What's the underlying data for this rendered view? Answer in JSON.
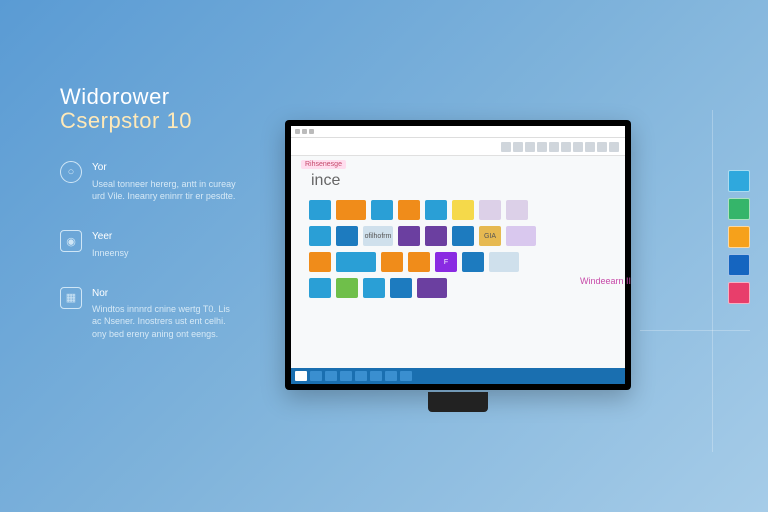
{
  "brand": {
    "line1": "Widorower",
    "line2": "Cserpstor 10"
  },
  "features": [
    {
      "title": "Yor",
      "body": "Useal tonneer hererg, antt in cureay urd Vile. Ineanry eninrr tir er pesdte."
    },
    {
      "title": "Yeer",
      "body": "Inneensy"
    },
    {
      "title": "Nor",
      "body": "Windtos innnrd cnine wertg T0. Lis ac Nsener. Inostrers ust ent celhi. ony bed ereny aning ont eengs."
    }
  ],
  "window": {
    "url_chip": "Rihsenesge",
    "doc_title": "ince",
    "caption_right": "Windeearn II",
    "ribbon_count": 10,
    "taskbar_count": 8
  },
  "tiles": {
    "row1": [
      {
        "c": "#2a9fd6",
        "w": "sm"
      },
      {
        "c": "#f08c1a",
        "w": "md"
      },
      {
        "c": "#2a9fd6",
        "w": "sm"
      },
      {
        "c": "#f08c1a",
        "w": "sm"
      },
      {
        "c": "#2a9fd6",
        "w": "sm"
      },
      {
        "c": "#f5d94a",
        "w": "sm"
      },
      {
        "c": "#dcd0e8",
        "w": "sm"
      },
      {
        "c": "#dcd0e8",
        "w": "sm"
      }
    ],
    "row2": [
      {
        "c": "#2a9fd6",
        "w": "sm"
      },
      {
        "c": "#1d7bbf",
        "w": "sm"
      },
      {
        "c": "#cfe0ec",
        "w": "md",
        "label": "ofilhofrm"
      },
      {
        "c": "#6b3fa0",
        "w": "sm"
      },
      {
        "c": "#6b3fa0",
        "w": "sm"
      },
      {
        "c": "#1d7bbf",
        "w": "sm"
      },
      {
        "c": "#e6b951",
        "w": "sm",
        "label": "GIA"
      },
      {
        "c": "#d9c8ee",
        "w": "md"
      }
    ],
    "row3": [
      {
        "c": "#f08c1a",
        "w": "sm"
      },
      {
        "c": "#2a9fd6",
        "w": "lg"
      },
      {
        "c": "#f08c1a",
        "w": "sm"
      },
      {
        "c": "#f08c1a",
        "w": "sm"
      },
      {
        "c": "#8a2be2",
        "w": "sm",
        "label": "F"
      },
      {
        "c": "#1d7bbf",
        "w": "sm"
      },
      {
        "c": "#cfe0ec",
        "w": "md"
      }
    ],
    "row4": [
      {
        "c": "#2a9fd6",
        "w": "sm"
      },
      {
        "c": "#6fbf4a",
        "w": "sm"
      },
      {
        "c": "#2a9fd6",
        "w": "sm"
      },
      {
        "c": "#1d7bbf",
        "w": "sm"
      },
      {
        "c": "#6b3fa0",
        "w": "md"
      }
    ]
  },
  "palette": [
    {
      "c": "#2fa8dd"
    },
    {
      "c": "#35b56a"
    },
    {
      "c": "#f6a11b"
    },
    {
      "c": "#1565c0"
    },
    {
      "c": "#e83e6b"
    }
  ]
}
